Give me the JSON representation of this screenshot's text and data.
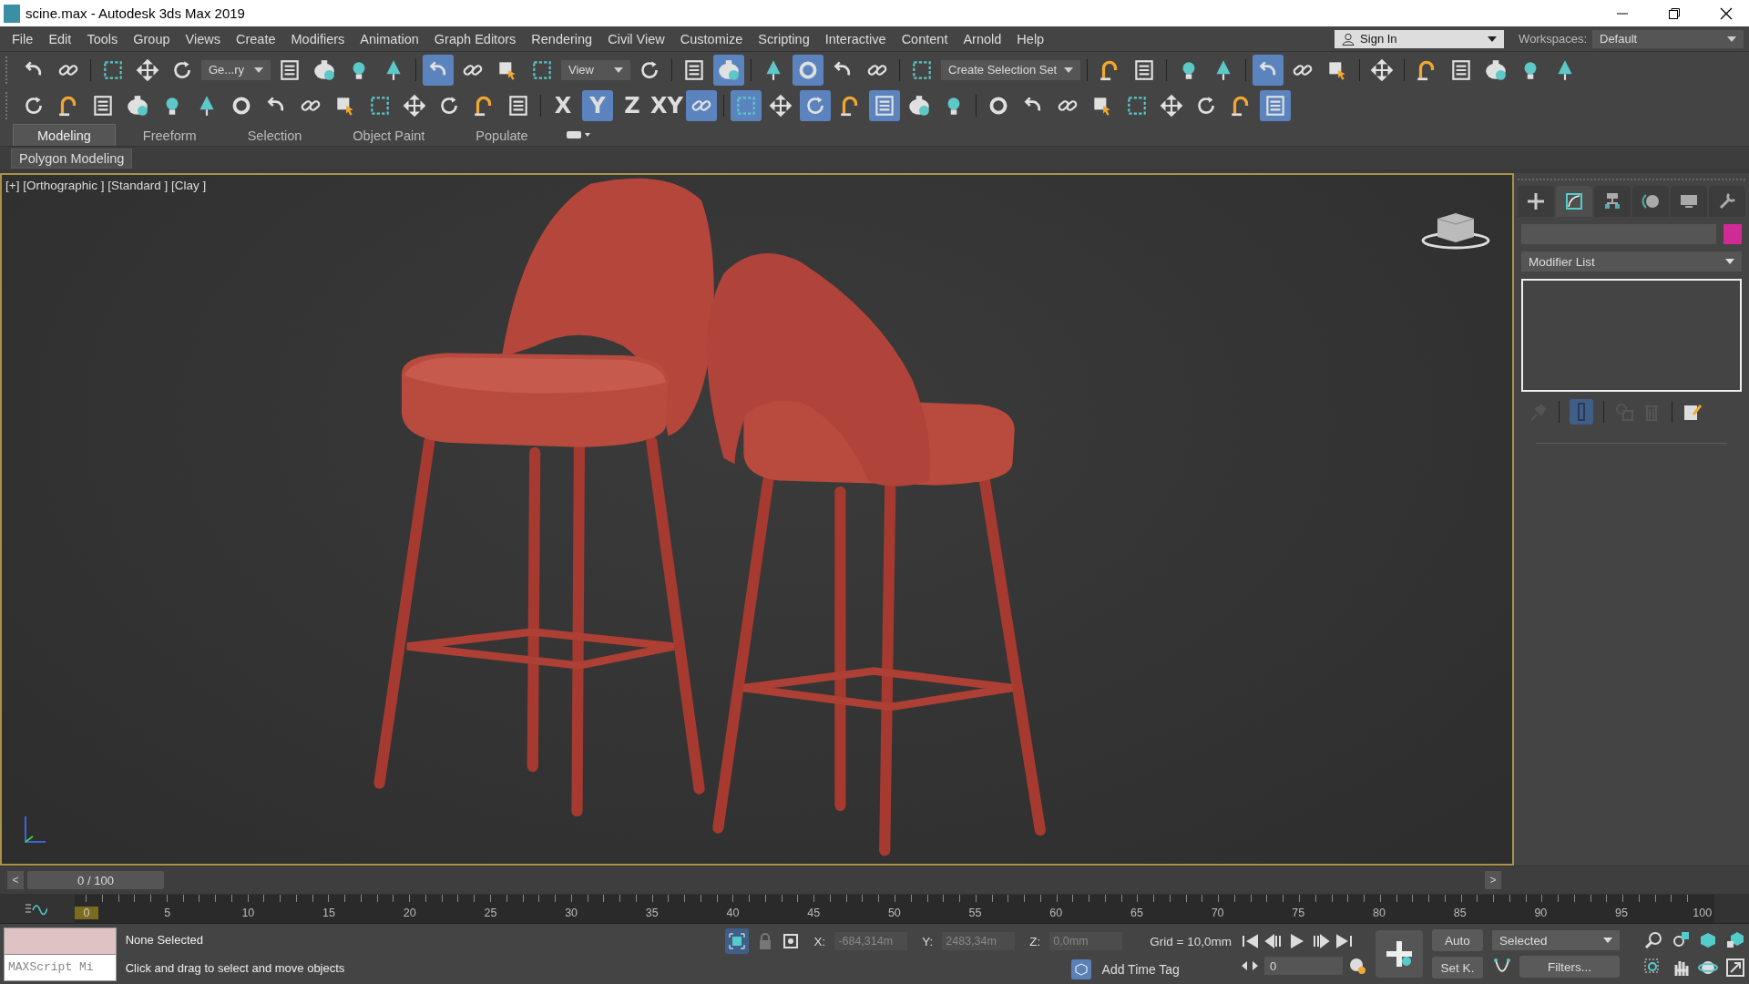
{
  "window": {
    "title": "scine.max - Autodesk 3ds Max 2019"
  },
  "menu": [
    "File",
    "Edit",
    "Tools",
    "Group",
    "Views",
    "Create",
    "Modifiers",
    "Animation",
    "Graph Editors",
    "Rendering",
    "Civil View",
    "Customize",
    "Scripting",
    "Interactive",
    "Content",
    "Arnold",
    "Help"
  ],
  "account": {
    "label": "Sign In"
  },
  "workspaces": {
    "label": "Workspaces:",
    "value": "Default"
  },
  "toolbar_main": [
    {
      "kind": "icon",
      "on": false
    },
    {
      "kind": "icon",
      "on": false
    },
    {
      "kind": "sep"
    },
    {
      "kind": "icon",
      "on": false
    },
    {
      "kind": "icon",
      "on": false
    },
    {
      "kind": "icon",
      "on": false
    },
    {
      "kind": "dropdown",
      "value": "Ge...ry"
    },
    {
      "kind": "icon",
      "on": false
    },
    {
      "kind": "icon",
      "on": false
    },
    {
      "kind": "icon",
      "on": false
    },
    {
      "kind": "icon",
      "on": false
    },
    {
      "kind": "sep"
    },
    {
      "kind": "icon",
      "on": true
    },
    {
      "kind": "icon",
      "on": false
    },
    {
      "kind": "icon",
      "on": false
    },
    {
      "kind": "icon",
      "on": false
    },
    {
      "kind": "dropdown",
      "value": "View"
    },
    {
      "kind": "icon",
      "on": false
    },
    {
      "kind": "sep"
    },
    {
      "kind": "icon",
      "on": false
    },
    {
      "kind": "icon",
      "on": true
    },
    {
      "kind": "sep"
    },
    {
      "kind": "icon",
      "on": false
    },
    {
      "kind": "icon",
      "on": true
    },
    {
      "kind": "icon",
      "on": false
    },
    {
      "kind": "icon",
      "on": false
    },
    {
      "kind": "sep"
    },
    {
      "kind": "icon",
      "on": false
    },
    {
      "kind": "dropdown",
      "value": "Create Selection Set"
    },
    {
      "kind": "sep"
    },
    {
      "kind": "icon",
      "on": false
    },
    {
      "kind": "icon",
      "on": false
    },
    {
      "kind": "sep"
    },
    {
      "kind": "icon",
      "on": false
    },
    {
      "kind": "icon",
      "on": false
    },
    {
      "kind": "sep"
    },
    {
      "kind": "icon",
      "on": true
    },
    {
      "kind": "icon",
      "on": false
    },
    {
      "kind": "icon",
      "on": false
    },
    {
      "kind": "sep"
    },
    {
      "kind": "icon",
      "on": false
    },
    {
      "kind": "sep"
    },
    {
      "kind": "icon",
      "on": false
    },
    {
      "kind": "icon",
      "on": false
    },
    {
      "kind": "icon",
      "on": false
    },
    {
      "kind": "icon",
      "on": false
    },
    {
      "kind": "icon",
      "on": false
    }
  ],
  "toolbar_second": [
    {
      "kind": "icon",
      "on": false
    },
    {
      "kind": "icon",
      "on": false
    },
    {
      "kind": "icon",
      "on": false
    },
    {
      "kind": "icon",
      "on": false
    },
    {
      "kind": "icon",
      "on": false
    },
    {
      "kind": "icon",
      "on": false
    },
    {
      "kind": "icon",
      "on": false
    },
    {
      "kind": "icon",
      "on": false
    },
    {
      "kind": "icon",
      "on": false
    },
    {
      "kind": "icon",
      "on": false
    },
    {
      "kind": "icon",
      "on": false
    },
    {
      "kind": "icon",
      "on": false
    },
    {
      "kind": "icon",
      "on": false
    },
    {
      "kind": "icon",
      "on": false
    },
    {
      "kind": "icon",
      "on": false
    },
    {
      "kind": "sep"
    },
    {
      "kind": "text",
      "label": "X",
      "on": false
    },
    {
      "kind": "text",
      "label": "Y",
      "on": true
    },
    {
      "kind": "text",
      "label": "Z",
      "on": false
    },
    {
      "kind": "text",
      "label": "XY",
      "on": false
    },
    {
      "kind": "icon",
      "on": true
    },
    {
      "kind": "sep"
    },
    {
      "kind": "icon",
      "on": true
    },
    {
      "kind": "icon",
      "on": false
    },
    {
      "kind": "icon",
      "on": true
    },
    {
      "kind": "icon",
      "on": false
    },
    {
      "kind": "icon",
      "on": true
    },
    {
      "kind": "icon",
      "on": false
    },
    {
      "kind": "icon",
      "on": false
    },
    {
      "kind": "sep"
    },
    {
      "kind": "icon",
      "on": false
    },
    {
      "kind": "icon",
      "on": false
    },
    {
      "kind": "icon",
      "on": false
    },
    {
      "kind": "icon",
      "on": false
    },
    {
      "kind": "icon",
      "on": false
    },
    {
      "kind": "icon",
      "on": false
    },
    {
      "kind": "icon",
      "on": false
    },
    {
      "kind": "icon",
      "on": false
    },
    {
      "kind": "icon",
      "on": true
    }
  ],
  "ribbon_tabs": [
    {
      "label": "Modeling",
      "selected": true
    },
    {
      "label": "Freeform",
      "selected": false
    },
    {
      "label": "Selection",
      "selected": false
    },
    {
      "label": "Object Paint",
      "selected": false
    },
    {
      "label": "Populate",
      "selected": false
    }
  ],
  "ribbon_panel": {
    "label": "Polygon Modeling"
  },
  "viewport": {
    "label": "[+] [Orthographic ] [Standard ] [Clay ]",
    "active": true
  },
  "command_panel": {
    "tabs": [
      {
        "selected": false
      },
      {
        "selected": true
      },
      {
        "selected": false
      },
      {
        "selected": false
      },
      {
        "selected": false
      },
      {
        "selected": false
      }
    ],
    "modifier_list": "Modifier List"
  },
  "time_slider": {
    "prev": "<",
    "frame": "0 / 100",
    "next": ">",
    "level": 0
  },
  "track_ticks": [
    "0",
    "5",
    "10",
    "15",
    "20",
    "25",
    "30",
    "35",
    "40",
    "45",
    "50",
    "55",
    "60",
    "65",
    "70",
    "75",
    "80",
    "85",
    "90",
    "95",
    "100"
  ],
  "status": {
    "script_field": "MAXScript Mi",
    "selection": "None Selected",
    "prompt": "Click and drag to select and move objects",
    "x_label": "X:",
    "x": "-684,314m",
    "y_label": "Y:",
    "y": "2483,34m",
    "z_label": "Z:",
    "z": "0,0mm",
    "grid": "Grid = 10,0mm",
    "time_tag": "Add Time Tag",
    "frame": "0",
    "auto": "Auto",
    "set_key": "Set K.",
    "key_filter": "Selected",
    "filters": "Filters..."
  }
}
